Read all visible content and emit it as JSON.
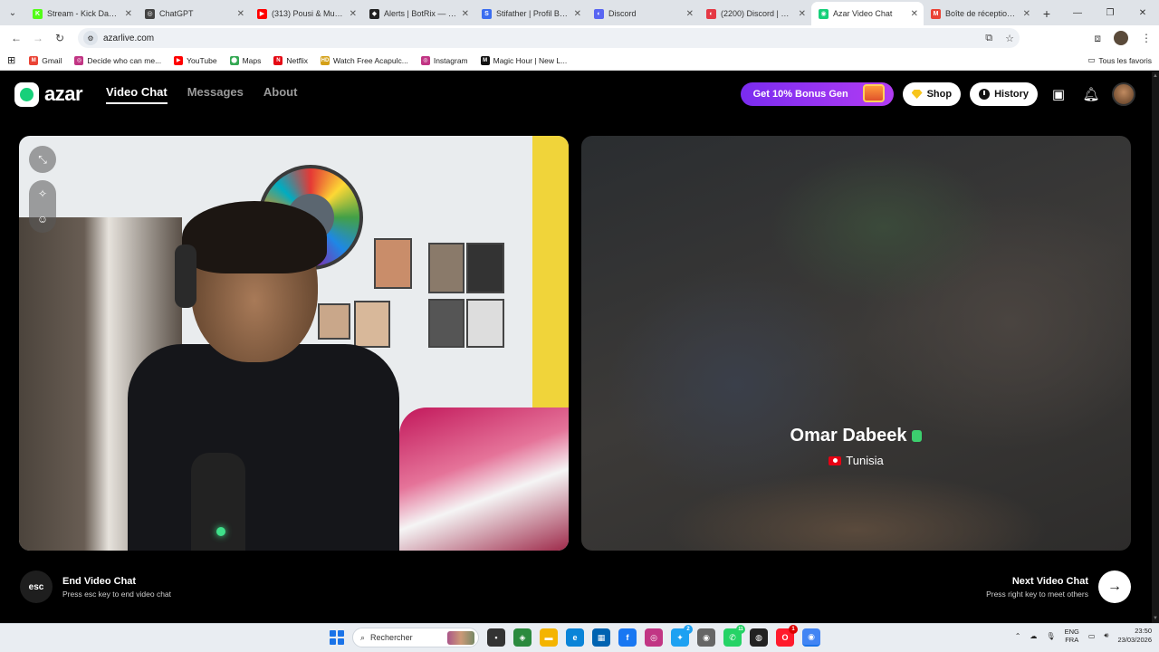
{
  "browser": {
    "tabs": [
      {
        "title": "Stream - Kick Dashbo",
        "fav_color": "#53fc18",
        "fav_text": "K",
        "active": false
      },
      {
        "title": "ChatGPT",
        "fav_color": "#444444",
        "fav_text": "◎",
        "active": false
      },
      {
        "title": "(313) Pousi & Muslim",
        "fav_color": "#ff0000",
        "fav_text": "▶",
        "active": false
      },
      {
        "title": "Alerts | BotRix — Clo",
        "fav_color": "#222222",
        "fav_text": "◆",
        "active": false
      },
      {
        "title": "Stifather | Profil Bakch",
        "fav_color": "#3b6df0",
        "fav_text": "S",
        "active": false
      },
      {
        "title": "Discord",
        "fav_color": "#5865f2",
        "fav_text": "◐",
        "active": false
      },
      {
        "title": "(2200) Discord | Frie",
        "fav_color": "#e53945",
        "fav_text": "◐",
        "active": false
      },
      {
        "title": "Azar Video Chat",
        "fav_color": "#17d07a",
        "fav_text": "◉",
        "active": true
      },
      {
        "title": "Boîte de réception (3",
        "fav_color": "#ea4335",
        "fav_text": "M",
        "active": false
      }
    ],
    "url": "azarlive.com",
    "bookmarks": [
      {
        "label": "Gmail",
        "color": "#ea4335",
        "text": "M"
      },
      {
        "label": "Decide who can me...",
        "color": "#c13584",
        "text": "◎"
      },
      {
        "label": "YouTube",
        "color": "#ff0000",
        "text": "▶"
      },
      {
        "label": "Maps",
        "color": "#34a853",
        "text": "⬤"
      },
      {
        "label": "Netflix",
        "color": "#e50914",
        "text": "N"
      },
      {
        "label": "Watch Free Acapulc...",
        "color": "#d4a017",
        "text": "HD"
      },
      {
        "label": "Instagram",
        "color": "#c13584",
        "text": "◎"
      },
      {
        "label": "Magic Hour | New L...",
        "color": "#111111",
        "text": "M"
      }
    ],
    "all_bookmarks": "Tous les favoris"
  },
  "azar": {
    "logo": "azar",
    "nav": {
      "video_chat": "Video Chat",
      "messages": "Messages",
      "about": "About"
    },
    "bonus_label": "Get 10% Bonus Gen",
    "shop_label": "Shop",
    "history_label": "History",
    "peer": {
      "name": "Omar Dabeek",
      "country": "Tunisia"
    },
    "end_chat": {
      "key": "esc",
      "title": "End Video Chat",
      "hint": "Press esc key to end video chat"
    },
    "next_chat": {
      "title": "Next Video Chat",
      "hint": "Press right key to meet others"
    }
  },
  "taskbar": {
    "search_placeholder": "Rechercher",
    "lang_top": "ENG",
    "lang_bottom": "FRA",
    "time": "23:50",
    "date": "23/03/2026",
    "badges": {
      "whatsapp": "11",
      "opera": "1",
      "tweetdeck": "2"
    }
  }
}
